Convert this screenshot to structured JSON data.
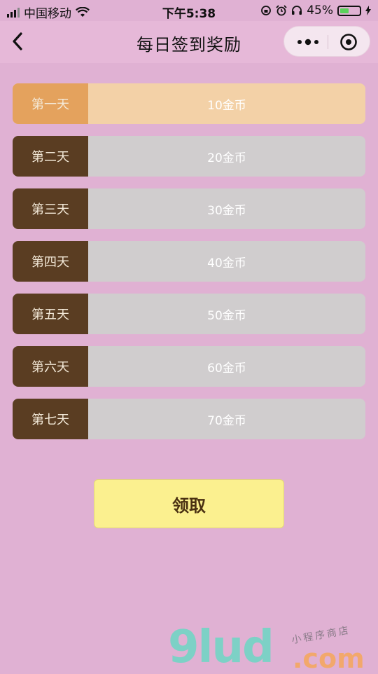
{
  "status_bar": {
    "carrier": "中国移动",
    "time": "下午5:38",
    "battery_percent": "45%",
    "battery_level": 0.45,
    "icons": [
      "signal-icon",
      "wifi-icon",
      "rotation-lock-icon",
      "alarm-icon",
      "headphones-icon",
      "battery-icon",
      "charging-icon"
    ]
  },
  "nav": {
    "title": "每日签到奖励",
    "icons": [
      "back-icon",
      "more-dots-icon",
      "close-target-icon"
    ]
  },
  "rewards": [
    {
      "day": "第一天",
      "reward": "10金币",
      "active": true
    },
    {
      "day": "第二天",
      "reward": "20金币",
      "active": false
    },
    {
      "day": "第三天",
      "reward": "30金币",
      "active": false
    },
    {
      "day": "第四天",
      "reward": "40金币",
      "active": false
    },
    {
      "day": "第五天",
      "reward": "50金币",
      "active": false
    },
    {
      "day": "第六天",
      "reward": "60金币",
      "active": false
    },
    {
      "day": "第七天",
      "reward": "70金币",
      "active": false
    }
  ],
  "claim_button": {
    "label": "领取"
  },
  "watermark": {
    "logo": "9lud",
    "domain": ".com",
    "tagline": "小程序商店"
  },
  "colors": {
    "background": "#e0b1d3",
    "active_day": "#e4a25d",
    "active_reward": "#f3d1a7",
    "day_label": "#5a3d22",
    "reward_bg": "#d0cdce",
    "claim_bg": "#fbf08f"
  }
}
